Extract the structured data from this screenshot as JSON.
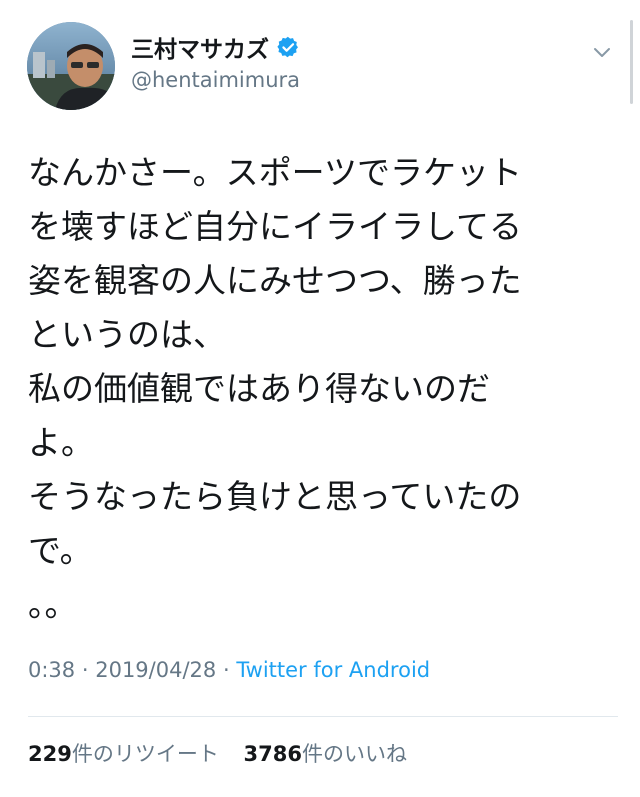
{
  "author": {
    "display_name": "三村マサカズ",
    "handle": "@hentaimimura",
    "verified": true
  },
  "tweet": {
    "lines": [
      "なんかさー。スポーツでラケット",
      "を壊すほど自分にイライラしてる",
      "姿を観客の人にみせつつ、勝った",
      "というのは、",
      "私の価値観ではあり得ないのだ",
      "よ。",
      "そうなったら負けと思っていたの",
      "で。",
      "。。"
    ],
    "time": "0:38",
    "date": "2019/04/28",
    "separator": "·",
    "source": "Twitter for Android"
  },
  "stats": {
    "retweets": "229",
    "retweets_label": "件のリツイート",
    "likes": "3786",
    "likes_label": "件のいいね"
  },
  "icons": {
    "verified": "verified-badge-icon",
    "caret": "chevron-down-icon"
  },
  "colors": {
    "accent": "#1da1f2",
    "secondary_text": "#657786",
    "primary_text": "#14171a",
    "divider": "#e1e8ed"
  }
}
